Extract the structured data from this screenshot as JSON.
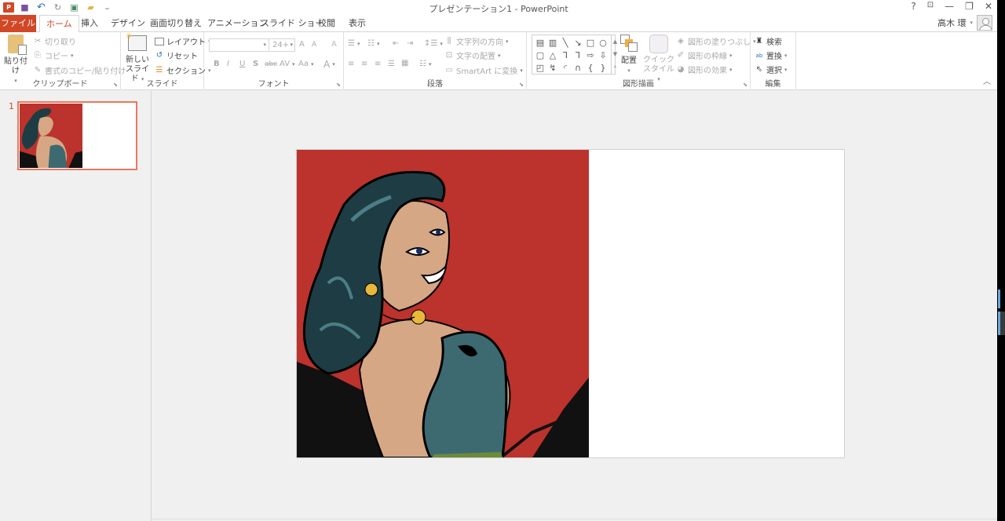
{
  "window": {
    "title": "プレゼンテーション1 - PowerPoint",
    "controls": {
      "help": "?",
      "ribbon_display": "⊡",
      "minimize": "—",
      "restore": "🗗",
      "close": "✕"
    }
  },
  "qat": {
    "logo": "P",
    "save_icon": "💾",
    "undo_icon": "↶",
    "undo_dd": "▾",
    "redo_icon": "↻",
    "slideshow_icon": "▣",
    "open_icon": "📂",
    "customize": "₌"
  },
  "tabs": [
    {
      "label": "ファイル"
    },
    {
      "label": "ホーム"
    },
    {
      "label": "挿入"
    },
    {
      "label": "デザイン"
    },
    {
      "label": "画面切り替え"
    },
    {
      "label": "アニメーション"
    },
    {
      "label": "スライド ショー"
    },
    {
      "label": "校閲"
    },
    {
      "label": "表示"
    }
  ],
  "user": {
    "name": "高木 環",
    "dd": "▾"
  },
  "ribbon": {
    "clipboard": {
      "label": "クリップボード",
      "paste": "貼り付け",
      "cut": "切り取り",
      "copy": "コピー",
      "format_painter": "書式のコピー/貼り付け"
    },
    "slides": {
      "label": "スライド",
      "new_slide_1": "新しい",
      "new_slide_2": "スライド",
      "layout": "レイアウト",
      "reset": "リセット",
      "section": "セクション"
    },
    "font": {
      "label": "フォント",
      "font_name": "",
      "font_size": "24+",
      "grow": "A",
      "shrink": "A",
      "clear": "A",
      "bold": "B",
      "italic": "I",
      "underline": "U",
      "shadow": "S",
      "strike": "abc",
      "spacing": "AV",
      "case": "Aa",
      "color": "A"
    },
    "paragraph": {
      "label": "段落",
      "text_direction": "文字列の方向",
      "align_text": "文字の配置",
      "smartart": "SmartArt に変換"
    },
    "drawing": {
      "label": "図形描画",
      "shapes": [
        "▤",
        "▥",
        "╲",
        "↘",
        "□",
        "○",
        "▢",
        "△",
        "⅂",
        "⅂",
        "⇨",
        "⇩",
        "◰",
        "↯",
        "◜",
        "∩",
        "{",
        "}"
      ],
      "arrange": "配置",
      "quick_style_1": "クイック",
      "quick_style_2": "スタイル",
      "fill": "図形の塗りつぶし",
      "outline": "図形の枠線",
      "effects": "図形の効果"
    },
    "editing": {
      "label": "編集",
      "find": "検索",
      "replace": "置換",
      "select": "選択"
    }
  },
  "thumbnails": [
    {
      "number": "1"
    }
  ],
  "colors": {
    "accent": "#d24726",
    "thumb_border": "#e8795e",
    "slide_bg": "#bc322c"
  }
}
